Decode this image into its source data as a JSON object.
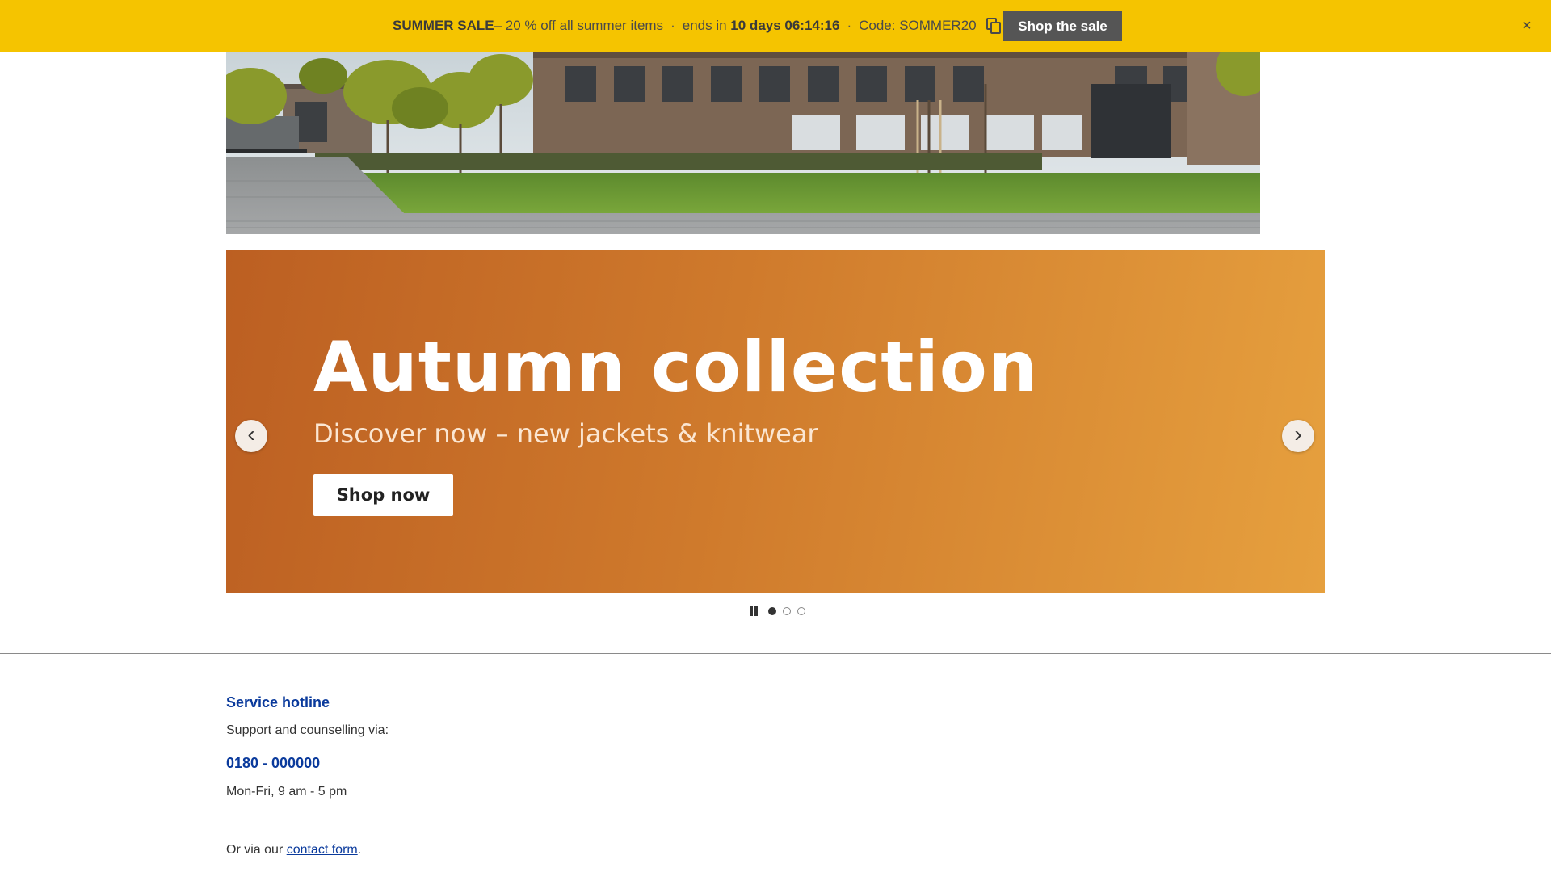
{
  "promo": {
    "sale_label": "SUMMER SALE",
    "sale_desc": " – 20 % off all summer items",
    "sep": "·",
    "ends_prefix": "ends in ",
    "countdown": "10 days 06:14:16",
    "code_text": "Code: SOMMER20",
    "copy_icon": "copy-icon",
    "button_label": "Shop the sale",
    "close_icon": "×",
    "bg_color": "#f5c400"
  },
  "hero": {
    "photo": "wooden building with courtyard, trees and lawn"
  },
  "carousel": {
    "title": "Autumn collection",
    "subtitle": "Discover now – new jackets & knitwear",
    "button_label": "Shop now",
    "prev_arrow": "‹",
    "next_arrow": "›",
    "slide_count": 3,
    "active_slide": 1
  },
  "service": {
    "title": "Service hotline",
    "intro": "Support and counselling via:",
    "phone": "0180 - 000000",
    "hours": "Mon-Fri, 9 am - 5 pm",
    "contact_prefix": "Or via our ",
    "contact_link": "contact form",
    "contact_suffix": "."
  }
}
